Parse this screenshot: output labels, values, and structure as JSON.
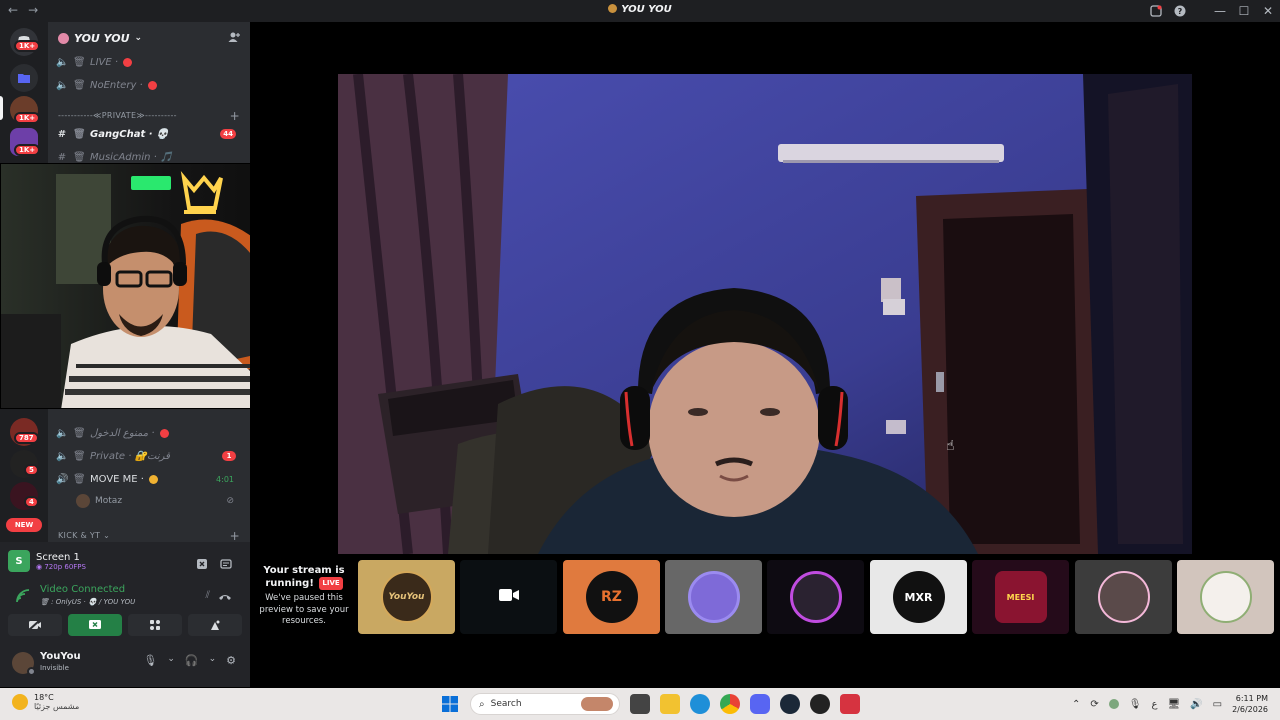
{
  "window": {
    "title": "YOU YOU",
    "nav_back": "←",
    "nav_forward": "→",
    "inbox_icon": "inbox-icon",
    "help_icon": "help-icon",
    "minimize": "—",
    "maximize": "☐",
    "close": "✕"
  },
  "server_rail": {
    "badges": [
      "1K+",
      "1K+",
      "1K+",
      "787",
      "5",
      "4"
    ],
    "new_label": "NEW"
  },
  "guild": {
    "name": "YOU YOU",
    "channels": [
      {
        "name": "LIVE ·",
        "type": "voice"
      },
      {
        "name": "NoEntery ·",
        "type": "voice"
      },
      {
        "name": "GangChat · 💀",
        "type": "text",
        "mention": "44"
      },
      {
        "name": "MusicAdmin · 🎵",
        "type": "text"
      },
      {
        "name": "ممنوع الدخول ·",
        "type": "voice"
      },
      {
        "name": "Private · 🔐قرنت",
        "type": "voice",
        "mention": "1"
      },
      {
        "name": "MOVE ME ·",
        "type": "voice",
        "time": "4:01"
      }
    ],
    "category_private": "-----------≪PRIVATE≫----------",
    "category_kick": "KICK & YT",
    "voice_member": "Motaz"
  },
  "voice_panel": {
    "screen_name": "Screen 1",
    "screen_meta": "720p 60FPS",
    "status": "Video Connected",
    "channel_path": "OnlyUS · 💀 / YOU YOU",
    "user_name": "YouYou",
    "user_status": "Invisible"
  },
  "stream_notice": {
    "title": "Your stream is running!",
    "live": "LIVE",
    "body": "We've paused this preview to save your resources."
  },
  "tiles": [
    {
      "label": "YouYou",
      "color": "#d4a85a",
      "bg": "#c9a862"
    },
    {
      "label": "camera-icon",
      "color": "#0d1117",
      "bg": "#0b0f12"
    },
    {
      "label": "RZ",
      "color": "#e8712f",
      "bg": "#e07a3e"
    },
    {
      "label": "",
      "color": "#6b5dd6",
      "bg": "#676767"
    },
    {
      "label": "",
      "color": "#3b2a6a",
      "bg": "#0e0b12"
    },
    {
      "label": "MXR",
      "color": "#111",
      "bg": "#e8e8e8"
    },
    {
      "label": "MEESI",
      "color": "#8a1430",
      "bg": "#250b1a"
    },
    {
      "label": "",
      "color": "#3a3a3a",
      "bg": "#3c3c3c"
    },
    {
      "label": "",
      "color": "#e8e0d8",
      "bg": "#d2c5bd"
    }
  ],
  "taskbar": {
    "temp": "18°C",
    "weather_desc": "مشمس جزئيًا",
    "search_placeholder": "Search",
    "time": "6:11 PM",
    "date": "2/6/2026",
    "lang": "ع"
  }
}
